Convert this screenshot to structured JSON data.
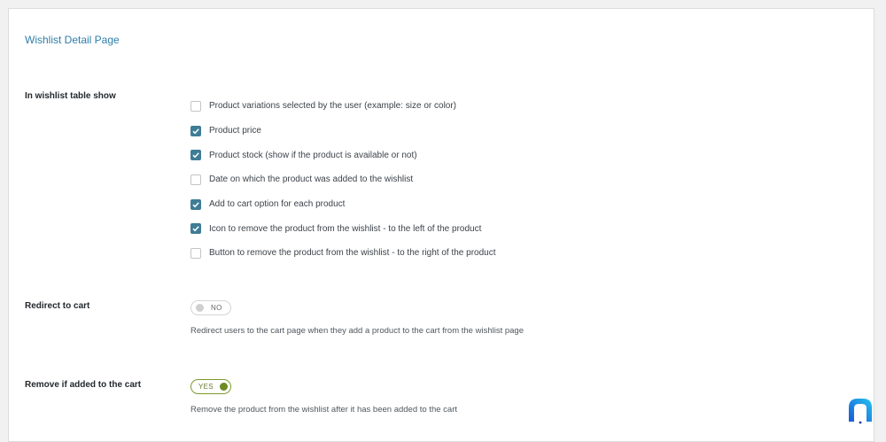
{
  "section": {
    "title": "Wishlist Detail Page"
  },
  "table_show": {
    "label": "In wishlist table show",
    "options": [
      {
        "label": "Product variations selected by the user (example: size or color)",
        "checked": false
      },
      {
        "label": "Product price",
        "checked": true
      },
      {
        "label": "Product stock (show if the product is available or not)",
        "checked": true
      },
      {
        "label": "Date on which the product was added to the wishlist",
        "checked": false
      },
      {
        "label": "Add to cart option for each product",
        "checked": true
      },
      {
        "label": "Icon to remove the product from the wishlist - to the left of the product",
        "checked": true
      },
      {
        "label": "Button to remove the product from the wishlist - to the right of the product",
        "checked": false
      }
    ]
  },
  "redirect": {
    "label": "Redirect to cart",
    "toggle_text": "NO",
    "enabled": false,
    "description": "Redirect users to the cart page when they add a product to the cart from the wishlist page"
  },
  "remove": {
    "label": "Remove if added to the cart",
    "toggle_text": "YES",
    "enabled": true,
    "description": "Remove the product from the wishlist after it has been added to the cart"
  },
  "colors": {
    "accent": "#3f7c95",
    "title": "#2f7ea8",
    "toggle_on": "#6e8b24"
  },
  "icons": {
    "check": "checkmark-icon",
    "brand": "brand-logo-icon"
  }
}
